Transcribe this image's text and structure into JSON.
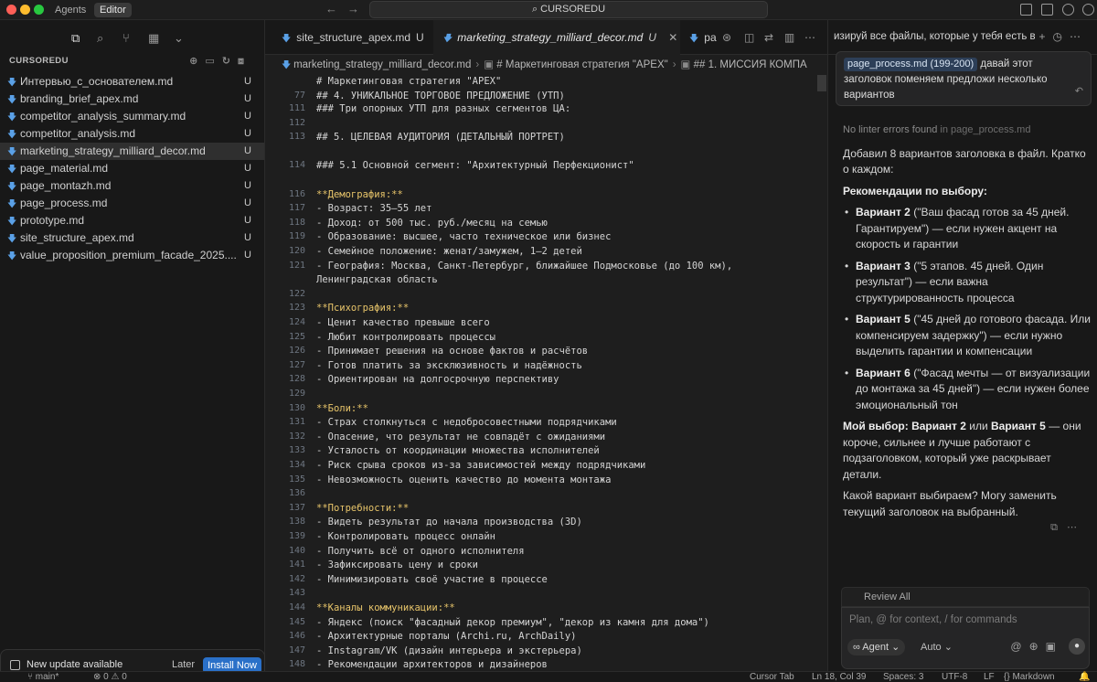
{
  "titlebar": {
    "tabs": [
      "Agents",
      "Editor"
    ],
    "active_tab": "Editor",
    "search": "CURSOREDU",
    "traffic_colors": [
      "#ff5f57",
      "#febc2e",
      "#28c840"
    ]
  },
  "sidebar": {
    "explorer_title": "CURSOREDU",
    "files": [
      {
        "name": "Интервью_с_основателем.md",
        "badge": "U"
      },
      {
        "name": "branding_brief_apex.md",
        "badge": "U"
      },
      {
        "name": "competitor_analysis_summary.md",
        "badge": "U"
      },
      {
        "name": "competitor_analysis.md",
        "badge": "U"
      },
      {
        "name": "marketing_strategy_milliard_decor.md",
        "badge": "U"
      },
      {
        "name": "page_material.md",
        "badge": "U"
      },
      {
        "name": "page_montazh.md",
        "badge": "U"
      },
      {
        "name": "page_process.md",
        "badge": "U"
      },
      {
        "name": "prototype.md",
        "badge": "U"
      },
      {
        "name": "site_structure_apex.md",
        "badge": "U"
      },
      {
        "name": "value_proposition_premium_facade_2025....",
        "badge": "U"
      }
    ],
    "selected_index": 4,
    "toast": {
      "text": "New update available",
      "later": "Later",
      "install": "Install Now"
    }
  },
  "editor": {
    "tabs": [
      {
        "name": "site_structure_apex.md",
        "badge": "U"
      },
      {
        "name": "marketing_strategy_milliard_decor.md",
        "badge": "U"
      },
      {
        "name": "pa",
        "badge": ""
      }
    ],
    "active_tab_index": 1,
    "breadcrumb": [
      "marketing_strategy_milliard_decor.md",
      "# Маркетинговая стратегия \"APEX\"",
      "## 1. МИССИЯ КОМПА"
    ],
    "sticky": [
      {
        "num": "",
        "text": "# Маркетинговая стратегия \"APEX\""
      },
      {
        "num": "77",
        "text": "## 4. УНИКАЛЬНОЕ ТОРГОВОЕ ПРЕДЛОЖЕНИЕ (УТП)"
      }
    ],
    "lines": [
      {
        "num": "111",
        "text": "### Три опорных УТП для разных сегментов ЦА:",
        "bold": false
      },
      {
        "num": "112",
        "text": "",
        "bold": false
      },
      {
        "num": "113",
        "text": "## 5. ЦЕЛЕВАЯ АУДИТОРИЯ (ДЕТАЛЬНЫЙ ПОРТРЕТ)",
        "bold": false
      },
      {
        "num": "",
        "text": "",
        "bold": false
      },
      {
        "num": "114",
        "text": "### 5.1 Основной сегмент: \"Архитектурный Перфекционист\"",
        "bold": false
      },
      {
        "num": "",
        "text": "",
        "bold": false
      },
      {
        "num": "116",
        "text": "**Демография:**",
        "bold": true
      },
      {
        "num": "117",
        "text": "- Возраст: 35–55 лет",
        "bold": false
      },
      {
        "num": "118",
        "text": "- Доход: от 500 тыс. руб./месяц на семью",
        "bold": false
      },
      {
        "num": "119",
        "text": "- Образование: высшее, часто техническое или бизнес",
        "bold": false
      },
      {
        "num": "120",
        "text": "- Семейное положение: женат/замужем, 1–2 детей",
        "bold": false
      },
      {
        "num": "121",
        "text": "- География: Москва, Санкт-Петербург, ближайшее Подмосковье (до 100 км),",
        "bold": false
      },
      {
        "num": "",
        "text": "Ленинградская область",
        "bold": false
      },
      {
        "num": "122",
        "text": "",
        "bold": false
      },
      {
        "num": "123",
        "text": "**Психография:**",
        "bold": true
      },
      {
        "num": "124",
        "text": "- Ценит качество превыше всего",
        "bold": false
      },
      {
        "num": "125",
        "text": "- Любит контролировать процессы",
        "bold": false
      },
      {
        "num": "126",
        "text": "- Принимает решения на основе фактов и расчётов",
        "bold": false
      },
      {
        "num": "127",
        "text": "- Готов платить за эксклюзивность и надёжность",
        "bold": false
      },
      {
        "num": "128",
        "text": "- Ориентирован на долгосрочную перспективу",
        "bold": false
      },
      {
        "num": "129",
        "text": "",
        "bold": false
      },
      {
        "num": "130",
        "text": "**Боли:**",
        "bold": true
      },
      {
        "num": "131",
        "text": "- Страх столкнуться с недобросовестными подрядчиками",
        "bold": false
      },
      {
        "num": "132",
        "text": "- Опасение, что результат не совпадёт с ожиданиями",
        "bold": false
      },
      {
        "num": "133",
        "text": "- Усталость от координации множества исполнителей",
        "bold": false
      },
      {
        "num": "134",
        "text": "- Риск срыва сроков из-за зависимостей между подрядчиками",
        "bold": false
      },
      {
        "num": "135",
        "text": "- Невозможность оценить качество до момента монтажа",
        "bold": false
      },
      {
        "num": "136",
        "text": "",
        "bold": false
      },
      {
        "num": "137",
        "text": "**Потребности:**",
        "bold": true
      },
      {
        "num": "138",
        "text": "- Видеть результат до начала производства (3D)",
        "bold": false
      },
      {
        "num": "139",
        "text": "- Контролировать процесс онлайн",
        "bold": false
      },
      {
        "num": "140",
        "text": "- Получить всё от одного исполнителя",
        "bold": false
      },
      {
        "num": "141",
        "text": "- Зафиксировать цену и сроки",
        "bold": false
      },
      {
        "num": "142",
        "text": "- Минимизировать своё участие в процессе",
        "bold": false
      },
      {
        "num": "143",
        "text": "",
        "bold": false
      },
      {
        "num": "144",
        "text": "**Каналы коммуникации:**",
        "bold": true
      },
      {
        "num": "145",
        "text": "- Яндекс (поиск \"фасадный декор премиум\", \"декор из камня для дома\")",
        "bold": false
      },
      {
        "num": "146",
        "text": "- Архитектурные порталы (Archi.ru, ArchDaily)",
        "bold": false
      },
      {
        "num": "147",
        "text": "- Instagram/VK (дизайн интерьера и экстерьера)",
        "bold": false
      },
      {
        "num": "148",
        "text": "- Рекомендации архитекторов и дизайнеров",
        "bold": false
      }
    ]
  },
  "chat": {
    "title": "изируй все файлы, которые у тебя есть в",
    "user_message": {
      "chip": "page_process.md (199-200)",
      "text": " давай этот заголовок поменяем предложи несколько вариантов"
    },
    "lint": {
      "text": "No linter errors found",
      "file": " in page_process.md"
    },
    "intro": "Добавил 8 вариантов заголовка в файл. Кратко о каждом:",
    "rec_title": "Рекомендации по выбору:",
    "options": [
      {
        "label": "Вариант 2",
        "text": " (\"Ваш фасад готов за 45 дней. Гарантируем\") — если нужен акцент на скорость и гарантии"
      },
      {
        "label": "Вариант 3",
        "text": " (\"5 этапов. 45 дней. Один результат\") — если важна структурированность процесса"
      },
      {
        "label": "Вариант 5",
        "text": " (\"45 дней до готового фасада. Или компенсируем задержку\") — если нужно выделить гарантии и компенсации"
      },
      {
        "label": "Вариант 6",
        "text": " (\"Фасад мечты — от визуализации до монтажа за 45 дней\") — если нужен более эмоциональный тон"
      }
    ],
    "choice": {
      "prefix": "Мой выбор: Вариант 2",
      "mid": " или ",
      "second": "Вариант 5",
      "rest": " — они короче, сильнее и лучше работают с подзаголовком, который уже раскрывает детали."
    },
    "question": "Какой вариант выбираем? Могу заменить текущий заголовок на выбранный.",
    "review_all": "Review All",
    "composer_placeholder": "Plan, @ for context, / for commands",
    "agent_label": "Agent",
    "auto_label": "Auto"
  },
  "statusbar": {
    "branch": "main*",
    "problems": "0",
    "warnings": "0",
    "cursor_tab": "Cursor Tab",
    "position": "Ln 18, Col 39",
    "spaces": "Spaces: 3",
    "encoding": "UTF-8",
    "eol": "LF",
    "language": "Markdown"
  }
}
